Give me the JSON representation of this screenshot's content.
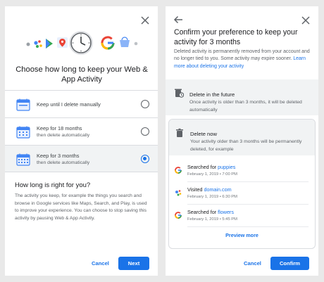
{
  "left_panel": {
    "title": "Choose how long to keep your Web & App Activity",
    "options": [
      {
        "label": "Keep until I delete manually",
        "sub": "",
        "selected": false
      },
      {
        "label": "Keep for 18 months",
        "sub": "then delete automatically",
        "selected": false
      },
      {
        "label": "Keep for 3 months",
        "sub": "then delete automatically",
        "selected": true
      }
    ],
    "section_heading": "How long is right for you?",
    "section_body": "The activity you keep, for example the things you search and browse in Google services like Maps, Search, and Play, is used to improve your experience. You can choose to stop saving this activity by pausing Web & App Activity.",
    "cancel_label": "Cancel",
    "next_label": "Next"
  },
  "right_panel": {
    "title": "Confirm your preference to keep your activity for 3 months",
    "desc": "Deleted activity is permanently removed from your account and no longer tied to you. Some activity may expire sooner.",
    "desc_link": "Learn more about deleting your activity",
    "future_title": "Delete in the future",
    "future_body": "Once activity is older than 3 months, it will be deleted automatically",
    "now_title": "Delete now",
    "now_body": "Your activity older than 3 months will be permanently deleted, for example",
    "activities": [
      {
        "prefix": "Searched for",
        "query": "puppies",
        "meta": "February 1, 2019 • 7:00 PM",
        "icon": "google-g-icon"
      },
      {
        "prefix": "Visited",
        "query": "domain.com",
        "meta": "February 1, 2019 • 6:30 PM",
        "icon": "assistant-icon"
      },
      {
        "prefix": "Searched for",
        "query": "flowers",
        "meta": "February 1, 2019 • 5:45 PM",
        "icon": "google-g-icon"
      }
    ],
    "preview_label": "Preview more",
    "cancel_label": "Cancel",
    "confirm_label": "Confirm"
  },
  "colors": {
    "accent": "#1a73e8",
    "panel_bg": "#ffffff",
    "page_bg": "#e9e9e9",
    "highlight": "#f1f3f4"
  }
}
